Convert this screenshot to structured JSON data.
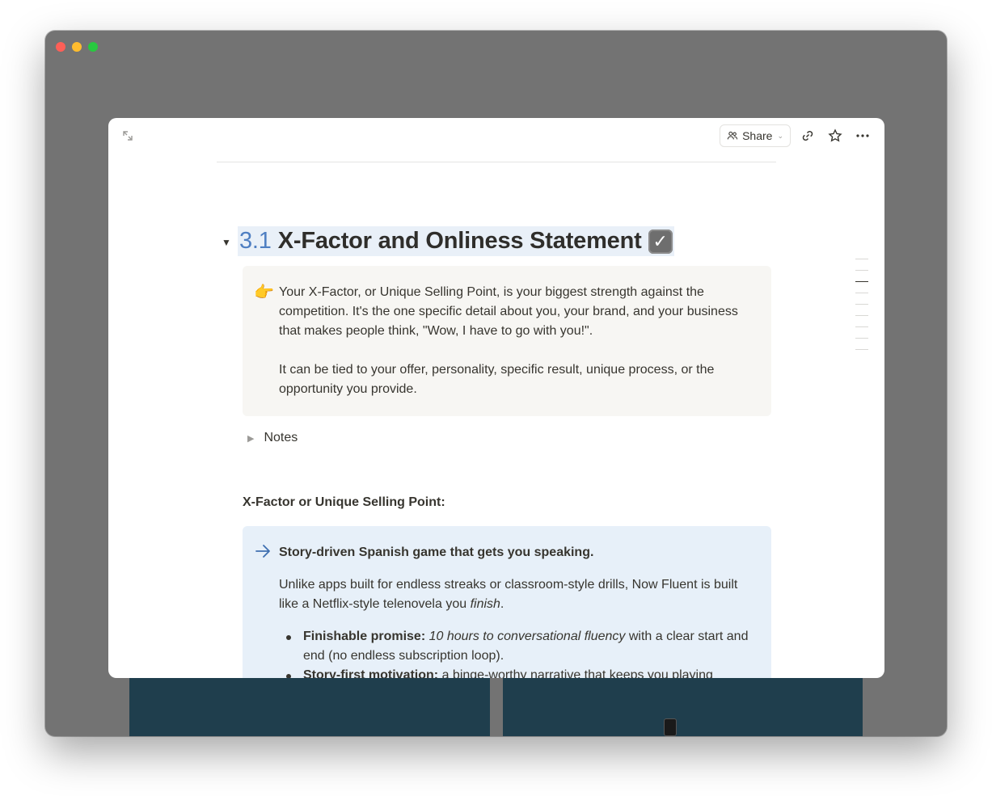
{
  "window": {
    "controls": [
      "close",
      "minimize",
      "maximize"
    ]
  },
  "topbar": {
    "expand_icon": "expand-arrows-icon",
    "share_label": "Share",
    "link_icon": "link-icon",
    "star_icon": "star-icon",
    "more_icon": "more-horizontal-icon"
  },
  "heading": {
    "number": "3.1",
    "title": "X-Factor and Onliness Statement",
    "check": "✓"
  },
  "callout_intro": {
    "emoji": "👉",
    "p1": "Your X-Factor, or Unique Selling Point, is your biggest strength against the competition. It's the one specific detail about you, your brand, and your business that makes people think, \"Wow, I have to go with you!\".",
    "p2": "It can be tied to your offer, personality, specific result, unique process, or the opportunity you provide."
  },
  "notes_toggle": {
    "label": "Notes"
  },
  "xfactor_label": "X-Factor or Unique Selling Point:",
  "callout_xfactor": {
    "title": "Story-driven Spanish game that gets you speaking.",
    "para_before": "Unlike apps built for endless streaks or classroom-style drills, Now Fluent is built like a Netflix-style telenovela you ",
    "para_italic": "finish",
    "para_after": ".",
    "bullets": [
      {
        "bold": "Finishable promise:",
        "italic": "10 hours to conversational fluency",
        "rest": " with a clear start and end (no endless subscription loop)."
      },
      {
        "bold": "Story-first motivation:",
        "italic": "",
        "rest": " a binge-worthy narrative that keeps you playing"
      }
    ]
  },
  "colors": {
    "accent_blue": "#4f7fc2",
    "callout_blue_bg": "#e7f0f9",
    "callout_gray_bg": "#f7f6f3"
  }
}
